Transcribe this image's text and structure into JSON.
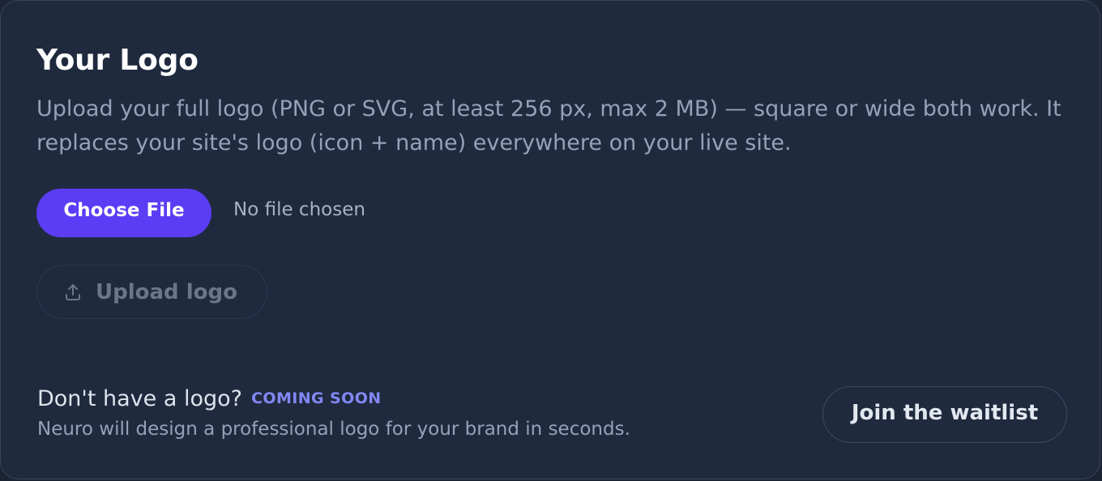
{
  "card": {
    "title": "Your Logo",
    "description": "Upload your full logo (PNG or SVG, at least 256 px, max 2 MB) — square or wide both work. It replaces your site's logo (icon + name) everywhere on your live site."
  },
  "file_input": {
    "choose_label": "Choose File",
    "status": "No file chosen"
  },
  "upload": {
    "label": "Upload logo",
    "icon": "upload-icon",
    "enabled": false
  },
  "promo": {
    "question": "Don't have a logo?",
    "badge": "COMING SOON",
    "subtext": "Neuro will design a professional logo for your brand in seconds.",
    "cta_label": "Join the waitlist"
  },
  "colors": {
    "background": "#1f2a3e",
    "accent": "#5b3df6",
    "badge": "#8288f4",
    "muted_text": "#95a1b7"
  }
}
